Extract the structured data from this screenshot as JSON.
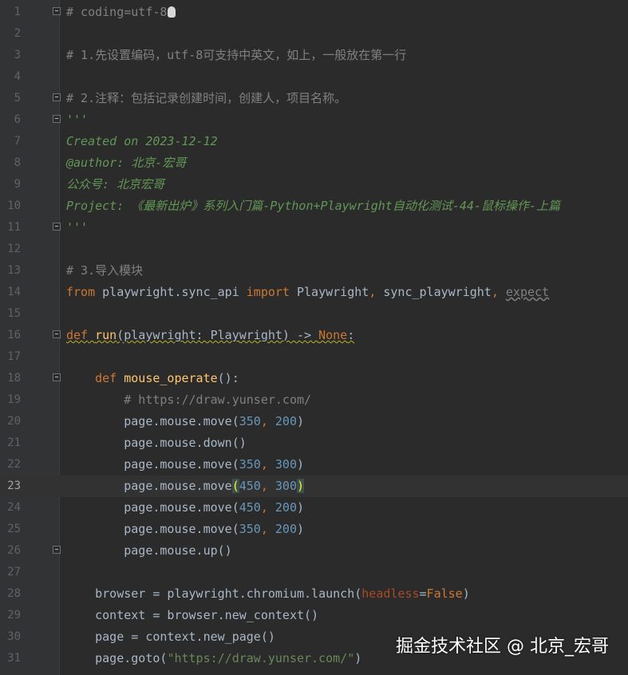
{
  "editor": {
    "current_line": 23,
    "lines": [
      {
        "n": "1",
        "segs": [
          {
            "t": "# coding=utf-8",
            "c": "cm"
          }
        ],
        "fold": true,
        "hand": true
      },
      {
        "n": "2",
        "segs": []
      },
      {
        "n": "3",
        "segs": [
          {
            "t": "# 1.先设置编码，utf-8可支持中英文，如上，一般放在第一行",
            "c": "cm"
          }
        ]
      },
      {
        "n": "4",
        "segs": []
      },
      {
        "n": "5",
        "segs": [
          {
            "t": "# 2.注释：包括记录创建时间，创建人，项目名称。",
            "c": "cm"
          }
        ],
        "fold": true
      },
      {
        "n": "6",
        "segs": [
          {
            "t": "'''",
            "c": "doc"
          }
        ],
        "fold": true
      },
      {
        "n": "7",
        "segs": [
          {
            "t": "Created on 2023-12-12",
            "c": "doc"
          }
        ]
      },
      {
        "n": "8",
        "segs": [
          {
            "t": "@author: 北京-宏哥",
            "c": "doc"
          }
        ]
      },
      {
        "n": "9",
        "segs": [
          {
            "t": "公众号: 北京宏哥",
            "c": "doc"
          }
        ]
      },
      {
        "n": "10",
        "segs": [
          {
            "t": "Project: 《最新出炉》系列入门篇-Python+Playwright自动化测试-44-鼠标操作-上篇",
            "c": "doc"
          }
        ]
      },
      {
        "n": "11",
        "segs": [
          {
            "t": "'''",
            "c": "doc"
          }
        ],
        "fold": true
      },
      {
        "n": "12",
        "segs": []
      },
      {
        "n": "13",
        "segs": [
          {
            "t": "# 3.导入模块",
            "c": "cm"
          }
        ]
      },
      {
        "n": "14",
        "segs": [
          {
            "t": "from",
            "c": "kw"
          },
          {
            "t": " playwright.sync_api ",
            "c": ""
          },
          {
            "t": "import",
            "c": "kw"
          },
          {
            "t": " Playwright",
            "c": ""
          },
          {
            "t": ", ",
            "c": "kw"
          },
          {
            "t": "sync_playwright",
            "c": ""
          },
          {
            "t": ", ",
            "c": "kw"
          },
          {
            "t": "expect",
            "c": "unused"
          }
        ]
      },
      {
        "n": "15",
        "segs": []
      },
      {
        "n": "16",
        "segs": [
          {
            "t": "def",
            "c": "kw squig"
          },
          {
            "t": " ",
            "c": "squig"
          },
          {
            "t": "run",
            "c": "fn squig"
          },
          {
            "t": "(playwright: Playwright) -> ",
            "c": "squig"
          },
          {
            "t": "None",
            "c": "kw squig"
          },
          {
            "t": ":",
            "c": "squig"
          }
        ],
        "fold": true
      },
      {
        "n": "17",
        "segs": []
      },
      {
        "n": "18",
        "segs": [
          {
            "t": "    ",
            "c": ""
          },
          {
            "t": "def",
            "c": "kw"
          },
          {
            "t": " ",
            "c": ""
          },
          {
            "t": "mouse_operate",
            "c": "fn"
          },
          {
            "t": "():",
            "c": ""
          }
        ],
        "fold": true
      },
      {
        "n": "19",
        "segs": [
          {
            "t": "        ",
            "c": ""
          },
          {
            "t": "# https://draw.yunser.com/",
            "c": "cm"
          }
        ]
      },
      {
        "n": "20",
        "segs": [
          {
            "t": "        page.mouse.move(",
            "c": ""
          },
          {
            "t": "350",
            "c": "num"
          },
          {
            "t": ", ",
            "c": "kw"
          },
          {
            "t": "200",
            "c": "num"
          },
          {
            "t": ")",
            "c": ""
          }
        ]
      },
      {
        "n": "21",
        "segs": [
          {
            "t": "        page.mouse.down()",
            "c": ""
          }
        ]
      },
      {
        "n": "22",
        "segs": [
          {
            "t": "        page.mouse.move(",
            "c": ""
          },
          {
            "t": "350",
            "c": "num"
          },
          {
            "t": ", ",
            "c": "kw"
          },
          {
            "t": "300",
            "c": "num"
          },
          {
            "t": ")",
            "c": ""
          }
        ]
      },
      {
        "n": "23",
        "segs": [
          {
            "t": "        page.mouse.move",
            "c": ""
          },
          {
            "t": "(",
            "c": "brace-hl"
          },
          {
            "t": "450",
            "c": "num"
          },
          {
            "t": ", ",
            "c": "kw"
          },
          {
            "t": "300",
            "c": "num"
          },
          {
            "t": ")",
            "c": "brace-hl"
          }
        ]
      },
      {
        "n": "24",
        "segs": [
          {
            "t": "        page.mouse.move(",
            "c": ""
          },
          {
            "t": "450",
            "c": "num"
          },
          {
            "t": ", ",
            "c": "kw"
          },
          {
            "t": "200",
            "c": "num"
          },
          {
            "t": ")",
            "c": ""
          }
        ]
      },
      {
        "n": "25",
        "segs": [
          {
            "t": "        page.mouse.move(",
            "c": ""
          },
          {
            "t": "350",
            "c": "num"
          },
          {
            "t": ", ",
            "c": "kw"
          },
          {
            "t": "200",
            "c": "num"
          },
          {
            "t": ")",
            "c": ""
          }
        ]
      },
      {
        "n": "26",
        "segs": [
          {
            "t": "        page.mouse.up()",
            "c": ""
          }
        ],
        "fold": true
      },
      {
        "n": "27",
        "segs": []
      },
      {
        "n": "28",
        "segs": [
          {
            "t": "    browser = playwright.chromium.launch(",
            "c": ""
          },
          {
            "t": "headless",
            "c": "param"
          },
          {
            "t": "=",
            "c": ""
          },
          {
            "t": "False",
            "c": "kw"
          },
          {
            "t": ")",
            "c": ""
          }
        ]
      },
      {
        "n": "29",
        "segs": [
          {
            "t": "    context = browser.new_context()",
            "c": ""
          }
        ]
      },
      {
        "n": "30",
        "segs": [
          {
            "t": "    page = context.new_page()",
            "c": ""
          }
        ]
      },
      {
        "n": "31",
        "segs": [
          {
            "t": "    page.goto(",
            "c": ""
          },
          {
            "t": "\"https://draw.yunser.com/\"",
            "c": "str"
          },
          {
            "t": ")",
            "c": ""
          }
        ]
      }
    ]
  },
  "watermark": {
    "text": "掘金技术社区 @ 北京_宏哥"
  }
}
